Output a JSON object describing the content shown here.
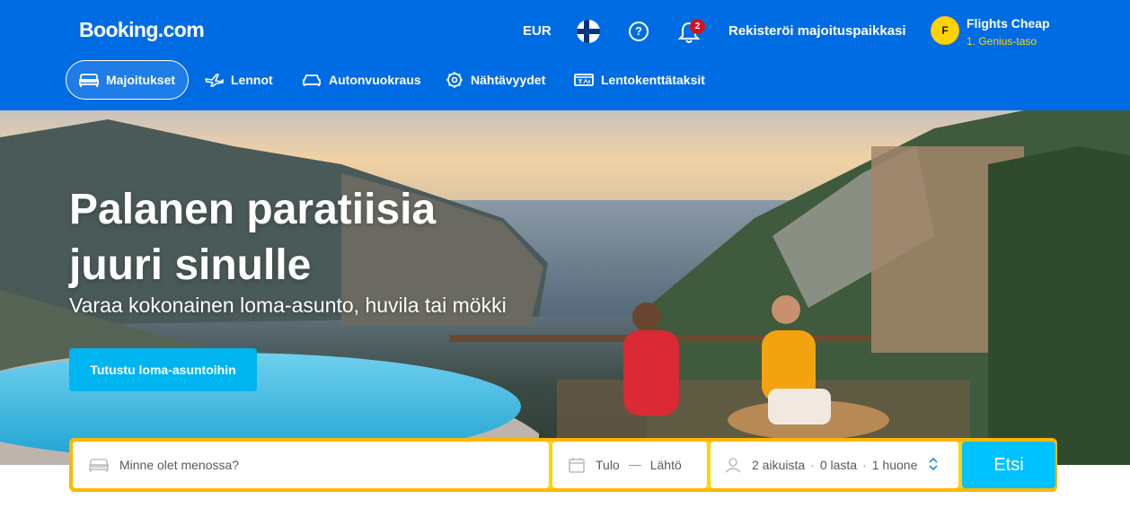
{
  "header": {
    "logo": "Booking.com",
    "currency": "EUR",
    "help_symbol": "?",
    "notifications_count": "2",
    "register_label": "Rekisteröi majoituspaikkasi",
    "avatar_initial": "F",
    "user_name": "Flights Cheap",
    "user_level": "1. Genius-taso"
  },
  "nav": {
    "items": [
      {
        "label": "Majoitukset",
        "icon": "bed-icon",
        "active": true
      },
      {
        "label": "Lennot",
        "icon": "plane-icon"
      },
      {
        "label": "Autonvuokraus",
        "icon": "car-icon"
      },
      {
        "label": "Nähtävyydet",
        "icon": "attractions-icon"
      },
      {
        "label": "Lentokenttätaksit",
        "icon": "taxi-icon"
      }
    ]
  },
  "hero": {
    "title_line1": "Palanen paratiisia",
    "title_line2": "juuri sinulle",
    "subtitle": "Varaa kokonainen loma-asunto, huvila tai mökki",
    "cta_label": "Tutustu loma-asuntoihin"
  },
  "search": {
    "destination_placeholder": "Minne olet menossa?",
    "checkin_label": "Tulo",
    "checkout_label": "Lähtö",
    "adults": "2 aikuista",
    "children": "0 lasta",
    "rooms": "1 huone",
    "separator": "·",
    "button_label": "Etsi"
  },
  "colors": {
    "brand_blue": "#006ce4",
    "cta_blue": "#00b4f0",
    "search_border": "#ffd400",
    "genius_yellow": "#ffd400",
    "badge_red": "#d4111e"
  }
}
